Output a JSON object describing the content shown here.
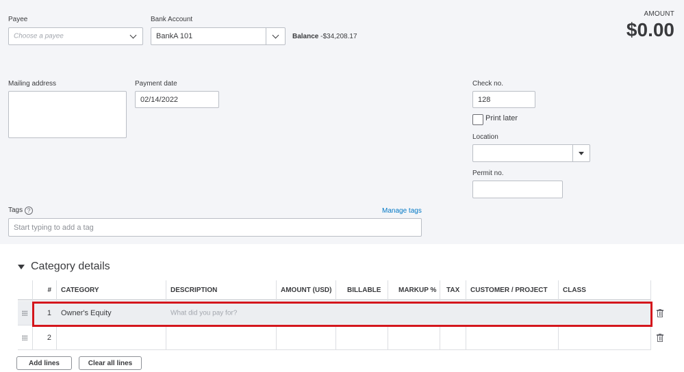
{
  "form": {
    "payee": {
      "label": "Payee",
      "placeholder": "Choose a payee"
    },
    "bank_account": {
      "label": "Bank Account",
      "value": "BankA 101"
    },
    "balance": {
      "label": "Balance",
      "value": "-$34,208.17"
    },
    "amount": {
      "label": "AMOUNT",
      "value": "$0.00"
    },
    "mailing_address": {
      "label": "Mailing address",
      "value": ""
    },
    "payment_date": {
      "label": "Payment date",
      "value": "02/14/2022"
    },
    "check_no": {
      "label": "Check no.",
      "value": "128"
    },
    "print_later": {
      "label": "Print later",
      "checked": false
    },
    "location": {
      "label": "Location",
      "value": ""
    },
    "permit_no": {
      "label": "Permit no.",
      "value": ""
    },
    "tags": {
      "label": "Tags",
      "help": "?",
      "manage_link": "Manage tags",
      "placeholder": "Start typing to add a tag"
    }
  },
  "category_details": {
    "title": "Category details",
    "columns": {
      "num": "#",
      "category": "CATEGORY",
      "description": "DESCRIPTION",
      "amount": "AMOUNT (USD)",
      "billable": "BILLABLE",
      "markup": "MARKUP %",
      "tax": "TAX",
      "customer": "CUSTOMER / PROJECT",
      "class": "CLASS"
    },
    "rows": [
      {
        "num": "1",
        "category": "Owner's Equity",
        "description_placeholder": "What did you pay for?"
      },
      {
        "num": "2",
        "category": "",
        "description_placeholder": ""
      }
    ],
    "add_lines": "Add lines",
    "clear_lines": "Clear all lines"
  },
  "colors": {
    "panel": "#f4f5f8",
    "highlight": "#d4161c",
    "link": "#0077c5"
  },
  "icons": [
    "chevron-down-icon",
    "dropdown-triangle-icon",
    "help-circle-icon",
    "collapse-caret-icon",
    "drag-grip-icon",
    "trash-icon"
  ]
}
